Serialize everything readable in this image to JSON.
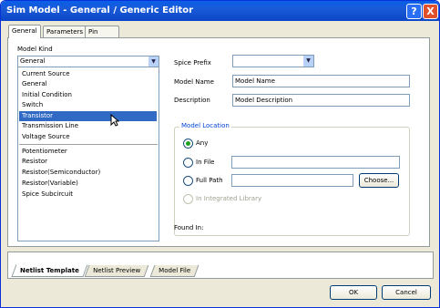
{
  "window": {
    "title": "Sim Model - General / Generic Editor",
    "help": "?",
    "close": "X"
  },
  "tabs": [
    {
      "label": "General"
    },
    {
      "label": "Parameters"
    },
    {
      "label": "Pin Mapping"
    }
  ],
  "model_kind": {
    "label": "Model Kind",
    "selected": "General",
    "items_top": [
      "Current Source",
      "General",
      "Initial Condition",
      "Switch",
      "Transistor",
      "Transmission Line",
      "Voltage Source"
    ],
    "items_bottom": [
      "Potentiometer",
      "Resistor",
      "Resistor(Semiconductor)",
      "Resistor(Variable)",
      "Spice Subcircuit"
    ],
    "highlighted": "Transistor"
  },
  "spice_prefix": {
    "label": "Spice Prefix",
    "value": ""
  },
  "model_name": {
    "label": "Model Name",
    "value": "Model Name"
  },
  "description": {
    "label": "Description",
    "value": "Model Description"
  },
  "model_location": {
    "label": "Model Location",
    "options": {
      "any": "Any",
      "in_file": "In File",
      "full_path": "Full Path",
      "integrated": "In Integrated Library"
    },
    "selected": "Any",
    "choose_label": "Choose..."
  },
  "found_in": {
    "label": "Found In:"
  },
  "bottom_tabs": [
    {
      "label": "Netlist Template"
    },
    {
      "label": "Netlist Preview"
    },
    {
      "label": "Model File"
    }
  ],
  "buttons": {
    "ok": "OK",
    "cancel": "Cancel"
  }
}
